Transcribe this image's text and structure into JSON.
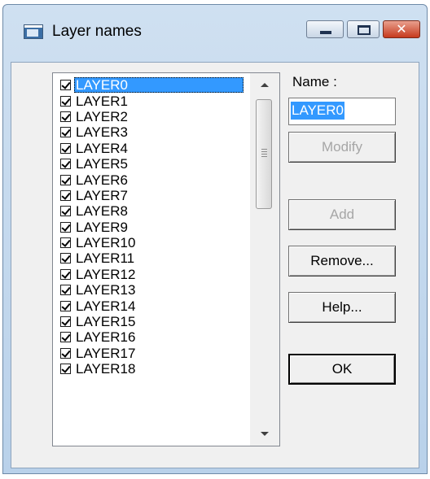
{
  "window": {
    "title": "Layer names"
  },
  "titlebar_buttons": {
    "close_glyph": "✕"
  },
  "layers": {
    "items": [
      {
        "label": "LAYER0",
        "checked": true,
        "selected": true
      },
      {
        "label": "LAYER1",
        "checked": true
      },
      {
        "label": "LAYER2",
        "checked": true
      },
      {
        "label": "LAYER3",
        "checked": true
      },
      {
        "label": "LAYER4",
        "checked": true
      },
      {
        "label": "LAYER5",
        "checked": true
      },
      {
        "label": "LAYER6",
        "checked": true
      },
      {
        "label": "LAYER7",
        "checked": true
      },
      {
        "label": "LAYER8",
        "checked": true
      },
      {
        "label": "LAYER9",
        "checked": true
      },
      {
        "label": "LAYER10",
        "checked": true
      },
      {
        "label": "LAYER11",
        "checked": true
      },
      {
        "label": "LAYER12",
        "checked": true
      },
      {
        "label": "LAYER13",
        "checked": true
      },
      {
        "label": "LAYER14",
        "checked": true
      },
      {
        "label": "LAYER15",
        "checked": true
      },
      {
        "label": "LAYER16",
        "checked": true
      },
      {
        "label": "LAYER17",
        "checked": true
      },
      {
        "label": "LAYER18",
        "checked": true
      }
    ]
  },
  "name": {
    "label": "Name :",
    "value": "LAYER0"
  },
  "buttons": {
    "modify": "Modify",
    "add": "Add",
    "remove": "Remove...",
    "help": "Help...",
    "ok": "OK"
  },
  "colors": {
    "selection": "#3399ff",
    "dialog_background": "#f0f0f0",
    "close_button": "#c63a1e"
  }
}
